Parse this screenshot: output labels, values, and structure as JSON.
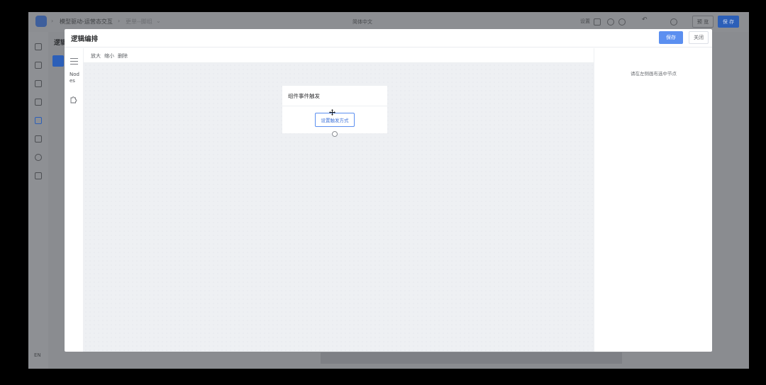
{
  "app": {
    "breadcrumb": [
      "模型驱动-运营态交互",
      "更单--脚组"
    ],
    "language_label": "简体中文",
    "topbar_text": "设置",
    "preview_label": "预 览",
    "publish_label": "保 存",
    "page_title": "逻辑",
    "sidebar_lang": "EN",
    "sidebar_code": "<>"
  },
  "modal": {
    "title": "逻辑编排",
    "save_label": "保存",
    "close_label": "关闭",
    "nodes_label": "Nodes",
    "toolbar": {
      "zoom_in": "放大",
      "zoom_out": "缩小",
      "delete": "删除"
    },
    "node": {
      "title": "组件事件触发",
      "action_label": "设置触发方式"
    },
    "right_panel_hint": "请在左侧画布选中节点"
  }
}
